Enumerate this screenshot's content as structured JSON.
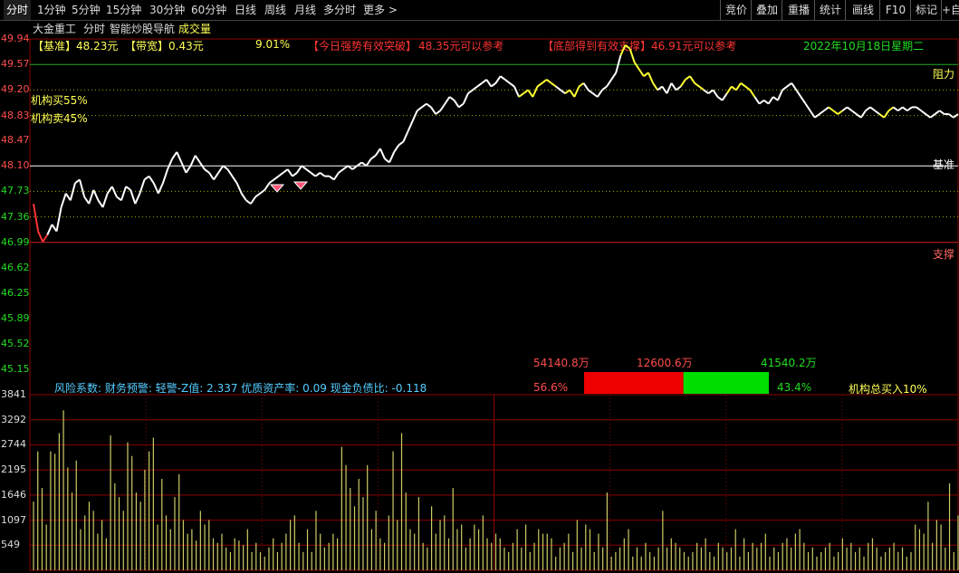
{
  "tabs": [
    "分时",
    "1分钟",
    "5分钟",
    "15分钟",
    "30分钟",
    "60分钟",
    "日线",
    "周线",
    "月线",
    "多分时",
    "更多 >"
  ],
  "right_tools": [
    "竞价",
    "叠加",
    "重播",
    "统计",
    "画线",
    "F10",
    "标记",
    "+自"
  ],
  "title": {
    "stock": "大金重工",
    "mode": "分时",
    "nav": "智能炒股导航",
    "indicator": "成交量"
  },
  "info": {
    "base_label": "【基准】",
    "base_value": "48.23元",
    "band_label": "【带宽】",
    "band_value": "0.43元",
    "pct": "9.01%",
    "breakout_label": "【今日强势有效突破】",
    "breakout_value": "48.35元可以参考",
    "support_label": "【底部得到有效支撑】",
    "support_value": "46.91元可以参考",
    "date": "2022年10月18日星期二"
  },
  "lines": {
    "resist": "阻力",
    "base": "基准",
    "support": "支撑",
    "inst_buy": "机构买55%",
    "inst_sell": "机构卖45%"
  },
  "risk_text": "风险系数: 财务预警: 轻警-Z值: 2.337 优质资产率: 0.09 现金负债比: -0.118",
  "flow": {
    "total": "54140.8万",
    "mid": "12600.6万",
    "right": "41540.2万",
    "pct_buy": "56.6%",
    "pct_sell": "43.4%",
    "inst_total": "机构总买入10%",
    "buy_frac": 0.566
  },
  "colors": {
    "price": "#ffffff",
    "price_hl": "#ffff33",
    "up": "#ff4d4d",
    "down": "#22dd22",
    "grid": "#8b0000",
    "vol": "#cccc66"
  },
  "chart_data": [
    {
      "type": "line",
      "y_ticks": [
        "49.94",
        "49.57",
        "49.20",
        "48.83",
        "48.47",
        "48.10",
        "47.73",
        "47.36",
        "46.99",
        "46.62",
        "46.25",
        "45.89",
        "45.52",
        "45.15"
      ],
      "ylim": [
        45.15,
        49.94
      ],
      "levels": {
        "resist": 49.57,
        "base": 48.1,
        "support": 46.99
      },
      "series": [
        {
          "values": [
            47.55,
            47.15,
            47.0,
            47.1,
            47.25,
            47.15,
            47.5,
            47.7,
            47.6,
            47.85,
            47.9,
            47.65,
            47.55,
            47.75,
            47.6,
            47.5,
            47.7,
            47.8,
            47.65,
            47.6,
            47.8,
            47.75,
            47.55,
            47.7,
            47.9,
            47.95,
            47.85,
            47.7,
            47.85,
            48.05,
            48.2,
            48.3,
            48.15,
            48.0,
            48.1,
            48.25,
            48.15,
            48.05,
            48.0,
            47.9,
            48.0,
            48.1,
            48.05,
            47.95,
            47.85,
            47.7,
            47.6,
            47.55,
            47.65,
            47.7,
            47.75,
            47.85,
            47.9,
            47.95,
            48.0,
            48.05,
            47.95,
            48.0,
            48.1,
            48.05,
            48.0,
            47.95,
            48.0,
            47.95,
            47.95,
            47.9,
            48.0,
            48.05,
            48.1,
            48.05,
            48.1,
            48.15,
            48.1,
            48.2,
            48.25,
            48.35,
            48.2,
            48.15,
            48.3,
            48.4,
            48.45,
            48.6,
            48.75,
            48.9,
            48.95,
            49.0,
            48.95,
            48.85,
            48.9,
            49.0,
            49.1,
            49.05,
            48.95,
            49.0,
            49.15,
            49.2,
            49.25,
            49.3,
            49.35,
            49.25,
            49.3,
            49.4,
            49.35,
            49.3,
            49.25,
            49.1,
            49.15,
            49.2,
            49.1,
            49.25,
            49.3,
            49.35,
            49.3,
            49.25,
            49.2,
            49.15,
            49.2,
            49.1,
            49.25,
            49.3,
            49.2,
            49.15,
            49.1,
            49.2,
            49.25,
            49.35,
            49.45,
            49.7,
            49.85,
            49.8,
            49.6,
            49.5,
            49.4,
            49.45,
            49.3,
            49.2,
            49.25,
            49.15,
            49.3,
            49.2,
            49.25,
            49.35,
            49.4,
            49.3,
            49.25,
            49.2,
            49.15,
            49.2,
            49.1,
            49.05,
            49.15,
            49.25,
            49.2,
            49.3,
            49.25,
            49.2,
            49.1,
            49.0,
            49.05,
            49.0,
            49.1,
            49.05,
            49.2,
            49.25,
            49.3,
            49.2,
            49.1,
            49.0,
            48.9,
            48.8,
            48.85,
            48.9,
            48.95,
            48.9,
            48.85,
            48.9,
            48.95,
            48.9,
            48.85,
            48.8,
            48.9,
            48.95,
            48.9,
            48.85,
            48.8,
            48.9,
            48.95,
            48.9,
            48.95,
            48.9,
            48.95,
            48.95,
            48.9,
            48.85,
            48.8,
            48.85,
            48.9,
            48.85,
            48.85,
            48.8,
            48.85
          ]
        }
      ]
    },
    {
      "type": "bar",
      "y_ticks": [
        "3841",
        "3292",
        "2744",
        "2195",
        "1646",
        "1097",
        "549"
      ],
      "ylim": [
        0,
        3841
      ],
      "values": [
        1500,
        2600,
        1800,
        1000,
        2600,
        2550,
        3000,
        3500,
        2250,
        1700,
        2400,
        900,
        1200,
        1500,
        1300,
        800,
        1100,
        700,
        2950,
        1900,
        1600,
        1300,
        2800,
        2500,
        1700,
        1500,
        2200,
        2600,
        2900,
        1000,
        2000,
        1200,
        900,
        1600,
        2100,
        1100,
        800,
        900,
        650,
        1300,
        1000,
        1100,
        700,
        600,
        800,
        500,
        400,
        700,
        650,
        550,
        900,
        400,
        600,
        400,
        300,
        500,
        700,
        400,
        600,
        800,
        1100,
        1200,
        600,
        400,
        900,
        400,
        1300,
        800,
        500,
        600,
        800,
        700,
        2700,
        2300,
        1800,
        1400,
        2000,
        1600,
        2300,
        900,
        1300,
        700,
        600,
        1200,
        2600,
        1100,
        3000,
        1700,
        900,
        800,
        1600,
        600,
        500,
        1400,
        800,
        1100,
        1200,
        700,
        1800,
        900,
        1000,
        500,
        700,
        1000,
        900,
        1200,
        700,
        600,
        800,
        700,
        500,
        400,
        600,
        900,
        500,
        1000,
        400,
        600,
        900,
        800,
        800,
        700,
        300,
        500,
        600,
        800,
        400,
        1100,
        500,
        1000,
        900,
        400,
        800,
        500,
        1700,
        300,
        400,
        500,
        700,
        900,
        300,
        500,
        300,
        600,
        400,
        300,
        500,
        1300,
        500,
        700,
        600,
        500,
        400,
        300,
        400,
        600,
        500,
        700,
        400,
        300,
        600,
        500,
        400,
        500,
        900,
        300,
        700,
        400,
        600,
        500,
        600,
        800,
        300,
        500,
        400,
        600,
        700,
        500,
        800,
        900,
        600,
        400,
        500,
        300,
        400,
        500,
        600,
        300,
        400,
        700,
        500,
        600,
        400,
        500,
        300,
        600,
        700,
        500,
        300,
        400,
        500,
        600,
        400,
        500,
        300,
        400,
        1000,
        900,
        800,
        1500,
        600,
        1100,
        1000,
        500,
        1900,
        400,
        1200
      ]
    }
  ]
}
